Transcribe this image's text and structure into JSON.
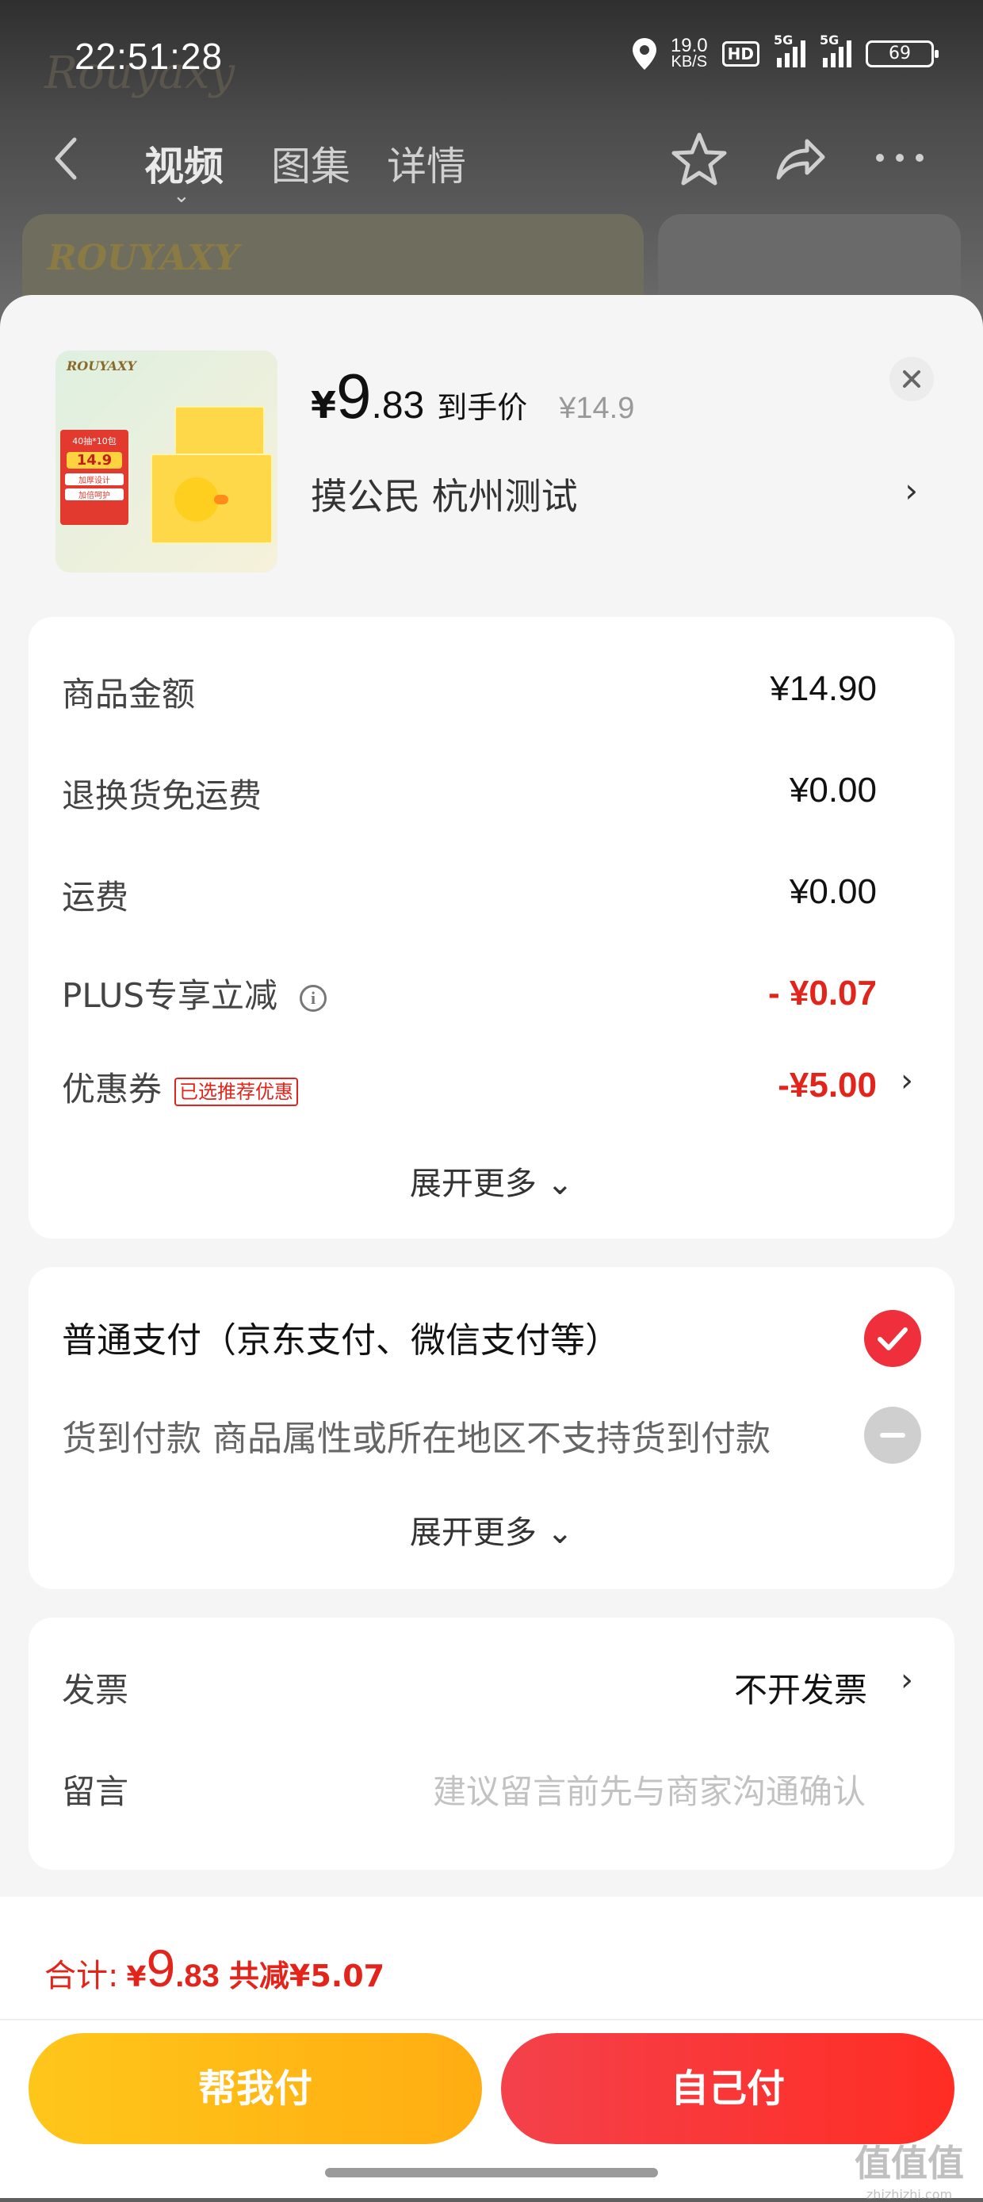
{
  "status_bar": {
    "time": "22:51:28",
    "net_speed_value": "19.0",
    "net_speed_unit": "KB/S",
    "hd_label": "HD",
    "signal1_label": "5G",
    "signal2_label": "5G",
    "battery": "69"
  },
  "nav": {
    "tabs": [
      {
        "label": "视频",
        "active": true
      },
      {
        "label": "图集",
        "active": false
      },
      {
        "label": "详情",
        "active": false
      }
    ],
    "brand_text": "Rouyaxy"
  },
  "product": {
    "thumb_brand": "ROUYAXY",
    "thumb_promo_line": "40抽*10包",
    "thumb_price": "14.9",
    "thumb_tag1": "加厚设计",
    "thumb_tag2": "加倍呵护",
    "price_yen": "¥",
    "price_int": "9",
    "price_dec": ".83",
    "price_tag": "到手价",
    "original_price": "¥14.9",
    "address": "摸公民  杭州测试"
  },
  "summary": {
    "rows": [
      {
        "label": "商品金额",
        "value": "¥14.90"
      },
      {
        "label": "退换货免运费",
        "value": "¥0.00"
      },
      {
        "label": "运费",
        "value": "¥0.00"
      },
      {
        "label": "PLUS专享立减",
        "value": "- ¥0.07"
      },
      {
        "label": "优惠券",
        "value": "-¥5.00",
        "tag": "已选推荐优惠"
      }
    ],
    "expand_label": "展开更多"
  },
  "payment": {
    "options": [
      {
        "label": "普通支付（京东支付、微信支付等）",
        "selected": true
      },
      {
        "label": "货到付款 商品属性或所在地区不支持货到付款",
        "selected": false
      }
    ],
    "expand_label": "展开更多"
  },
  "extras": {
    "invoice_label": "发票",
    "invoice_value": "不开发票",
    "message_label": "留言",
    "message_placeholder": "建议留言前先与商家沟通确认"
  },
  "footer": {
    "total_label": "合计:",
    "total_yen": "¥",
    "total_int": "9",
    "total_dec": ".83",
    "total_discount": "共减¥5.07",
    "help_pay_label": "帮我付",
    "self_pay_label": "自己付"
  },
  "watermark": {
    "text": "值值值",
    "sub": "zhizhizhi.com"
  },
  "colors": {
    "accent_red": "#e3241b",
    "pay_yellow": "#ffc61a",
    "pay_red": "#f4414b"
  }
}
